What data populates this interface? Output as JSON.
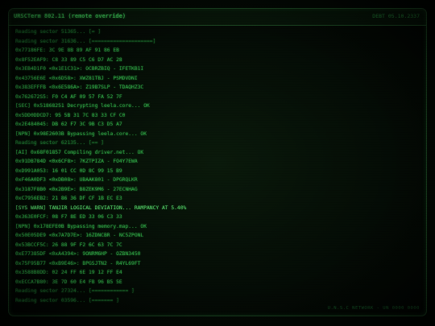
{
  "header": {
    "title": "URSCTerm 802.11 (remote override)",
    "stamp": "DEBT 05.10.2337"
  },
  "log": [
    "Reading sector 51365... [=                    ]",
    "Reading sector 31636... [====================]",
    "0x77186FE: 3C 9E 8B 89 AF 91 86 EB",
    "0x8F52EAF9: C8 33 89 C5 C6 D7 AC 28",
    "0x3EB4D1F0 <0x1E1C31>: OCBRZBIQ - IFETKB1I",
    "0x43756E6E <0x6D58>: XWZ81TBJ - PSMDVDNI",
    "0x383EFFFB <0x6E586A>: Z19B7SLP - TDAQHZ3C",
    "0x762672S5: F0 C4 AF 09 57 FA 52 7F",
    "[SEC] 0x51868251 Decrypting leela.core... OK",
    "0x5DD0DDCD7: 95 5B 31 7C 83 33 CF C0",
    "0x2E484045: DB 62 F7 3C 9B C3 D5 A7",
    "[NPN] 0x98E2603B Bypassing leela.core... OK",
    "Reading sector 62135... [==                  ]",
    "[AI] 0x68F01857 Compiling driver.net... OK",
    "0x91DB784D <0x6CF8>: 7KZTPIZA - FO4Y7EWA",
    "0xD991A053: 16 01 CC 0D 8C 99 15 B9",
    "0xF46A0DF3 <0xDB08>: UBAAK801 - DPGRQLKR",
    "0x3187F8B0 <0x2B9E>: B8ZEK9M6 - 27ECNHAG",
    "0xC7956EB2: 21 86 36 DF CF 1B EC E3",
    "[SYS WARN] TANJIR LOGICAL DEVIATION... RAMPANCY AT 5.40%",
    "0x363E0FCF: 08 F7 8E ED 33 06 C3 33",
    "[NPN] 0x178EFE0B Bypassing memory.map... OK",
    "0x50E05DE9 <0x7A7D7E>: 16ZDNCBR - NC5ZPONL",
    "0x53BCCF5C: 26 88 9F F2 6C 63 7C 7C",
    "0xE77385DF <0xA4394>: 9ONRM6HP - OZBN3450",
    "0x75F95B77 <0xB9E46>: BPGSJTN2 - R4YL69FT",
    "0x3588B8DD: 02 24 FF 6E 19 12 FF E4",
    "0xECCA7B80: 3E 7D 60 E4 FB 96 B5 5E",
    "Reading sector 27324... [============        ]",
    "Reading sector 03596... [=======             ]"
  ],
  "footer": {
    "text": "U.N.S.C NETWORK - UN 0000 0000"
  }
}
